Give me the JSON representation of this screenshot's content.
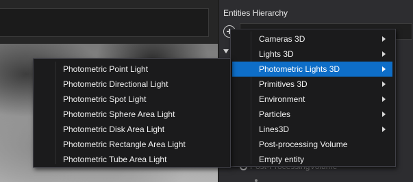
{
  "hierarchy": {
    "title": "Entities Hierarchy",
    "behind_item": "Post-ProcessingVolume"
  },
  "context_menu": {
    "items": [
      {
        "label": "Cameras 3D",
        "has_submenu": true
      },
      {
        "label": "Lights 3D",
        "has_submenu": true
      },
      {
        "label": "Photometric Lights 3D",
        "has_submenu": true,
        "highlighted": true
      },
      {
        "label": "Primitives 3D",
        "has_submenu": true
      },
      {
        "label": "Environment",
        "has_submenu": true
      },
      {
        "label": "Particles",
        "has_submenu": true
      },
      {
        "label": "Lines3D",
        "has_submenu": true
      },
      {
        "label": "Post-processing Volume",
        "has_submenu": false
      },
      {
        "label": "Empty entity",
        "has_submenu": false
      }
    ]
  },
  "submenu": {
    "items": [
      {
        "label": "Photometric Point Light"
      },
      {
        "label": "Photometric Directional Light"
      },
      {
        "label": "Photometric Spot Light"
      },
      {
        "label": "Photometric Sphere Area Light"
      },
      {
        "label": "Photometric Disk Area Light"
      },
      {
        "label": "Photometric Rectangle Area Light"
      },
      {
        "label": "Photometric Tube Area Light"
      }
    ]
  },
  "colors": {
    "highlight": "#0e6ec8",
    "menu_bg": "#1b1b1c",
    "panel_bg": "#2d2d30"
  }
}
